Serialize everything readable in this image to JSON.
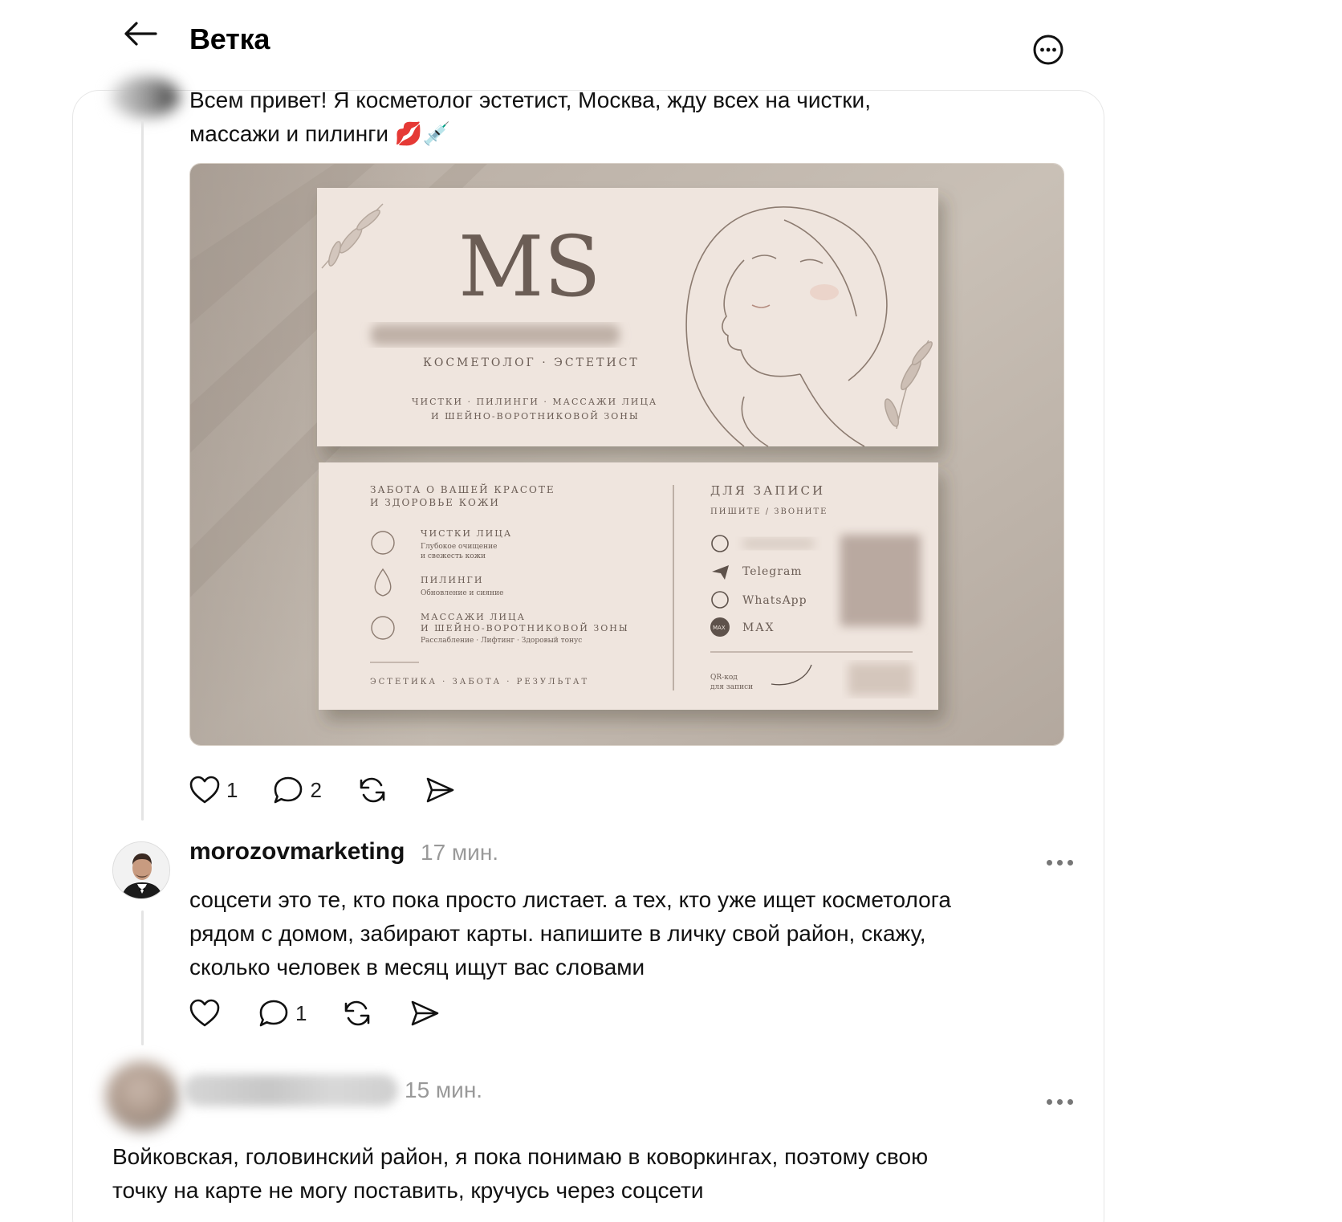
{
  "header": {
    "title": "Ветка"
  },
  "post": {
    "text_line1": "Всем привет! Я косметолог эстетист, Москва, жду всех на чистки,",
    "text_line2": "массажи и пилинги 💋💉",
    "image": {
      "monogram": "MS",
      "role": "КОСМЕТОЛОГ · ЭСТЕТИСТ",
      "services_line1": "ЧИСТКИ · ПИЛИНГИ · МАССАЖИ ЛИЦА",
      "services_line2": "И ШЕЙНО-ВОРОТНИКОВОЙ ЗОНЫ",
      "care_title_line1": "ЗАБОТА О ВАШЕЙ КРАСОТЕ",
      "care_title_line2": "И ЗДОРОВЬЕ КОЖИ",
      "services": [
        {
          "title": "ЧИСТКИ ЛИЦА",
          "desc1": "Глубокое очищение",
          "desc2": "и свежесть кожи"
        },
        {
          "title": "ПИЛИНГИ",
          "desc1": "Обновление и сияние",
          "desc2": ""
        },
        {
          "title": "МАССАЖИ ЛИЦА",
          "desc1": "И ШЕЙНО-ВОРОТНИКОВОЙ ЗОНЫ",
          "desc2": "Расслабление · Лифтинг · Здоровый тонус"
        }
      ],
      "footer_tags": "ЭСТЕТИКА  ·  ЗАБОТА  ·  РЕЗУЛЬТАТ",
      "contact_title": "ДЛЯ ЗАПИСИ",
      "contact_subtitle": "ПИШИТЕ / ЗВОНИТЕ",
      "contacts": [
        "Telegram",
        "WhatsApp",
        "MAX"
      ],
      "max_badge": "MAX",
      "qr_label_line1": "QR-код",
      "qr_label_line2": "для записи"
    },
    "likes": "1",
    "comments": "2"
  },
  "comment": {
    "username": "morozovmarketing",
    "time": "17 мин.",
    "text_line1": "соцсети это те, кто пока просто листает. а тех, кто уже ищет косметолога",
    "text_line2": "рядом с домом, забирают карты. напишите в личку свой район, скажу,",
    "text_line3": "сколько человек в месяц ищут вас словами",
    "comments": "1"
  },
  "reply": {
    "time": "15 мин.",
    "text_line1": "Войковская, головинский район, я пока понимаю в коворкингах, поэтому свою",
    "text_line2": "точку на карте не могу поставить, кручусь через соцсети"
  },
  "colors": {
    "text": "#111111",
    "muted": "#999999",
    "border": "#e6e6e6",
    "card_bg": "#efe6df",
    "card_ink": "#6b5d55"
  }
}
